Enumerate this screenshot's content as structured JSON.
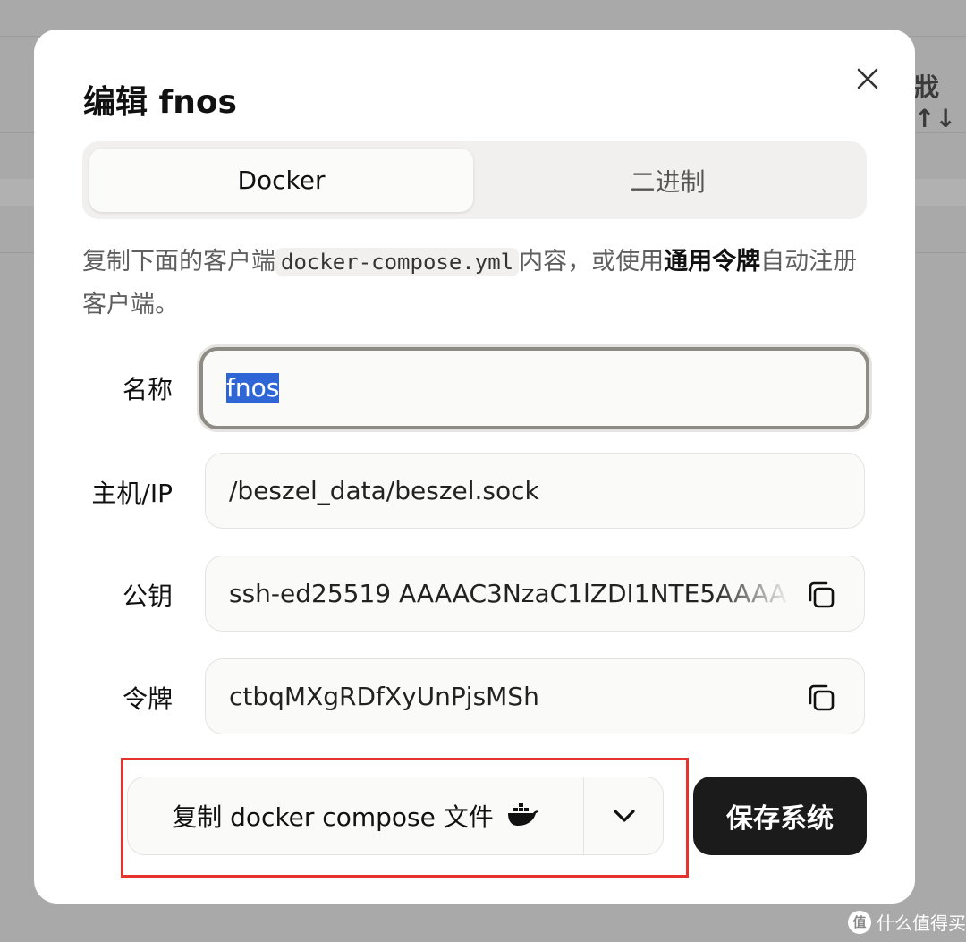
{
  "background": {
    "side_text": "戕 ↑↓"
  },
  "dialog": {
    "title": "编辑 fnos",
    "close_icon": "close-icon",
    "tabs": [
      {
        "label": "Docker",
        "active": true
      },
      {
        "label": "二进制",
        "active": false
      }
    ],
    "description": {
      "part1": "复制下面的客户端",
      "code": "docker-compose.yml",
      "part2": "内容，或使用",
      "bold": "通用令牌",
      "part3": "自动注册客户端。"
    },
    "fields": {
      "name": {
        "label": "名称",
        "value": "fnos"
      },
      "host": {
        "label": "主机/IP",
        "value": "/beszel_data/beszel.sock"
      },
      "pubkey": {
        "label": "公钥",
        "value": "ssh-ed25519 AAAAC3NzaC1lZDI1NTE5AAAA"
      },
      "token": {
        "label": "令牌",
        "value": "ctbqMXgRDfXyUnPjsMSh"
      }
    },
    "copy_compose_label": "复制 docker compose 文件",
    "save_label": "保存系统",
    "colors": {
      "highlight": "#e5322d",
      "save_bg": "#1b1b1b",
      "selection": "#2f66d6"
    }
  },
  "watermark": {
    "badge": "值",
    "text": "什么值得买"
  }
}
